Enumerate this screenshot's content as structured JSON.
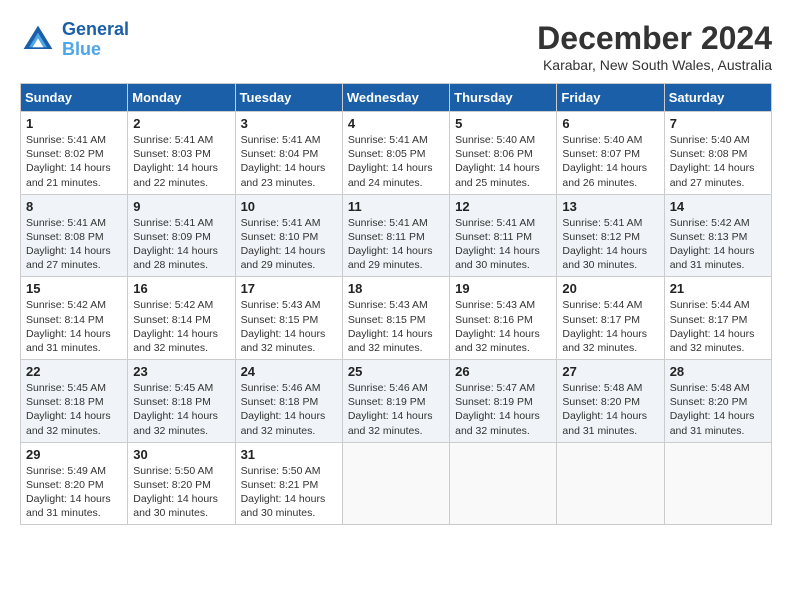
{
  "header": {
    "logo_line1": "General",
    "logo_line2": "Blue",
    "month_title": "December 2024",
    "location": "Karabar, New South Wales, Australia"
  },
  "weekdays": [
    "Sunday",
    "Monday",
    "Tuesday",
    "Wednesday",
    "Thursday",
    "Friday",
    "Saturday"
  ],
  "weeks": [
    [
      {
        "day": "1",
        "sunrise": "Sunrise: 5:41 AM",
        "sunset": "Sunset: 8:02 PM",
        "daylight": "Daylight: 14 hours and 21 minutes."
      },
      {
        "day": "2",
        "sunrise": "Sunrise: 5:41 AM",
        "sunset": "Sunset: 8:03 PM",
        "daylight": "Daylight: 14 hours and 22 minutes."
      },
      {
        "day": "3",
        "sunrise": "Sunrise: 5:41 AM",
        "sunset": "Sunset: 8:04 PM",
        "daylight": "Daylight: 14 hours and 23 minutes."
      },
      {
        "day": "4",
        "sunrise": "Sunrise: 5:41 AM",
        "sunset": "Sunset: 8:05 PM",
        "daylight": "Daylight: 14 hours and 24 minutes."
      },
      {
        "day": "5",
        "sunrise": "Sunrise: 5:40 AM",
        "sunset": "Sunset: 8:06 PM",
        "daylight": "Daylight: 14 hours and 25 minutes."
      },
      {
        "day": "6",
        "sunrise": "Sunrise: 5:40 AM",
        "sunset": "Sunset: 8:07 PM",
        "daylight": "Daylight: 14 hours and 26 minutes."
      },
      {
        "day": "7",
        "sunrise": "Sunrise: 5:40 AM",
        "sunset": "Sunset: 8:08 PM",
        "daylight": "Daylight: 14 hours and 27 minutes."
      }
    ],
    [
      {
        "day": "8",
        "sunrise": "Sunrise: 5:41 AM",
        "sunset": "Sunset: 8:08 PM",
        "daylight": "Daylight: 14 hours and 27 minutes."
      },
      {
        "day": "9",
        "sunrise": "Sunrise: 5:41 AM",
        "sunset": "Sunset: 8:09 PM",
        "daylight": "Daylight: 14 hours and 28 minutes."
      },
      {
        "day": "10",
        "sunrise": "Sunrise: 5:41 AM",
        "sunset": "Sunset: 8:10 PM",
        "daylight": "Daylight: 14 hours and 29 minutes."
      },
      {
        "day": "11",
        "sunrise": "Sunrise: 5:41 AM",
        "sunset": "Sunset: 8:11 PM",
        "daylight": "Daylight: 14 hours and 29 minutes."
      },
      {
        "day": "12",
        "sunrise": "Sunrise: 5:41 AM",
        "sunset": "Sunset: 8:11 PM",
        "daylight": "Daylight: 14 hours and 30 minutes."
      },
      {
        "day": "13",
        "sunrise": "Sunrise: 5:41 AM",
        "sunset": "Sunset: 8:12 PM",
        "daylight": "Daylight: 14 hours and 30 minutes."
      },
      {
        "day": "14",
        "sunrise": "Sunrise: 5:42 AM",
        "sunset": "Sunset: 8:13 PM",
        "daylight": "Daylight: 14 hours and 31 minutes."
      }
    ],
    [
      {
        "day": "15",
        "sunrise": "Sunrise: 5:42 AM",
        "sunset": "Sunset: 8:14 PM",
        "daylight": "Daylight: 14 hours and 31 minutes."
      },
      {
        "day": "16",
        "sunrise": "Sunrise: 5:42 AM",
        "sunset": "Sunset: 8:14 PM",
        "daylight": "Daylight: 14 hours and 32 minutes."
      },
      {
        "day": "17",
        "sunrise": "Sunrise: 5:43 AM",
        "sunset": "Sunset: 8:15 PM",
        "daylight": "Daylight: 14 hours and 32 minutes."
      },
      {
        "day": "18",
        "sunrise": "Sunrise: 5:43 AM",
        "sunset": "Sunset: 8:15 PM",
        "daylight": "Daylight: 14 hours and 32 minutes."
      },
      {
        "day": "19",
        "sunrise": "Sunrise: 5:43 AM",
        "sunset": "Sunset: 8:16 PM",
        "daylight": "Daylight: 14 hours and 32 minutes."
      },
      {
        "day": "20",
        "sunrise": "Sunrise: 5:44 AM",
        "sunset": "Sunset: 8:17 PM",
        "daylight": "Daylight: 14 hours and 32 minutes."
      },
      {
        "day": "21",
        "sunrise": "Sunrise: 5:44 AM",
        "sunset": "Sunset: 8:17 PM",
        "daylight": "Daylight: 14 hours and 32 minutes."
      }
    ],
    [
      {
        "day": "22",
        "sunrise": "Sunrise: 5:45 AM",
        "sunset": "Sunset: 8:18 PM",
        "daylight": "Daylight: 14 hours and 32 minutes."
      },
      {
        "day": "23",
        "sunrise": "Sunrise: 5:45 AM",
        "sunset": "Sunset: 8:18 PM",
        "daylight": "Daylight: 14 hours and 32 minutes."
      },
      {
        "day": "24",
        "sunrise": "Sunrise: 5:46 AM",
        "sunset": "Sunset: 8:18 PM",
        "daylight": "Daylight: 14 hours and 32 minutes."
      },
      {
        "day": "25",
        "sunrise": "Sunrise: 5:46 AM",
        "sunset": "Sunset: 8:19 PM",
        "daylight": "Daylight: 14 hours and 32 minutes."
      },
      {
        "day": "26",
        "sunrise": "Sunrise: 5:47 AM",
        "sunset": "Sunset: 8:19 PM",
        "daylight": "Daylight: 14 hours and 32 minutes."
      },
      {
        "day": "27",
        "sunrise": "Sunrise: 5:48 AM",
        "sunset": "Sunset: 8:20 PM",
        "daylight": "Daylight: 14 hours and 31 minutes."
      },
      {
        "day": "28",
        "sunrise": "Sunrise: 5:48 AM",
        "sunset": "Sunset: 8:20 PM",
        "daylight": "Daylight: 14 hours and 31 minutes."
      }
    ],
    [
      {
        "day": "29",
        "sunrise": "Sunrise: 5:49 AM",
        "sunset": "Sunset: 8:20 PM",
        "daylight": "Daylight: 14 hours and 31 minutes."
      },
      {
        "day": "30",
        "sunrise": "Sunrise: 5:50 AM",
        "sunset": "Sunset: 8:20 PM",
        "daylight": "Daylight: 14 hours and 30 minutes."
      },
      {
        "day": "31",
        "sunrise": "Sunrise: 5:50 AM",
        "sunset": "Sunset: 8:21 PM",
        "daylight": "Daylight: 14 hours and 30 minutes."
      },
      null,
      null,
      null,
      null
    ]
  ]
}
